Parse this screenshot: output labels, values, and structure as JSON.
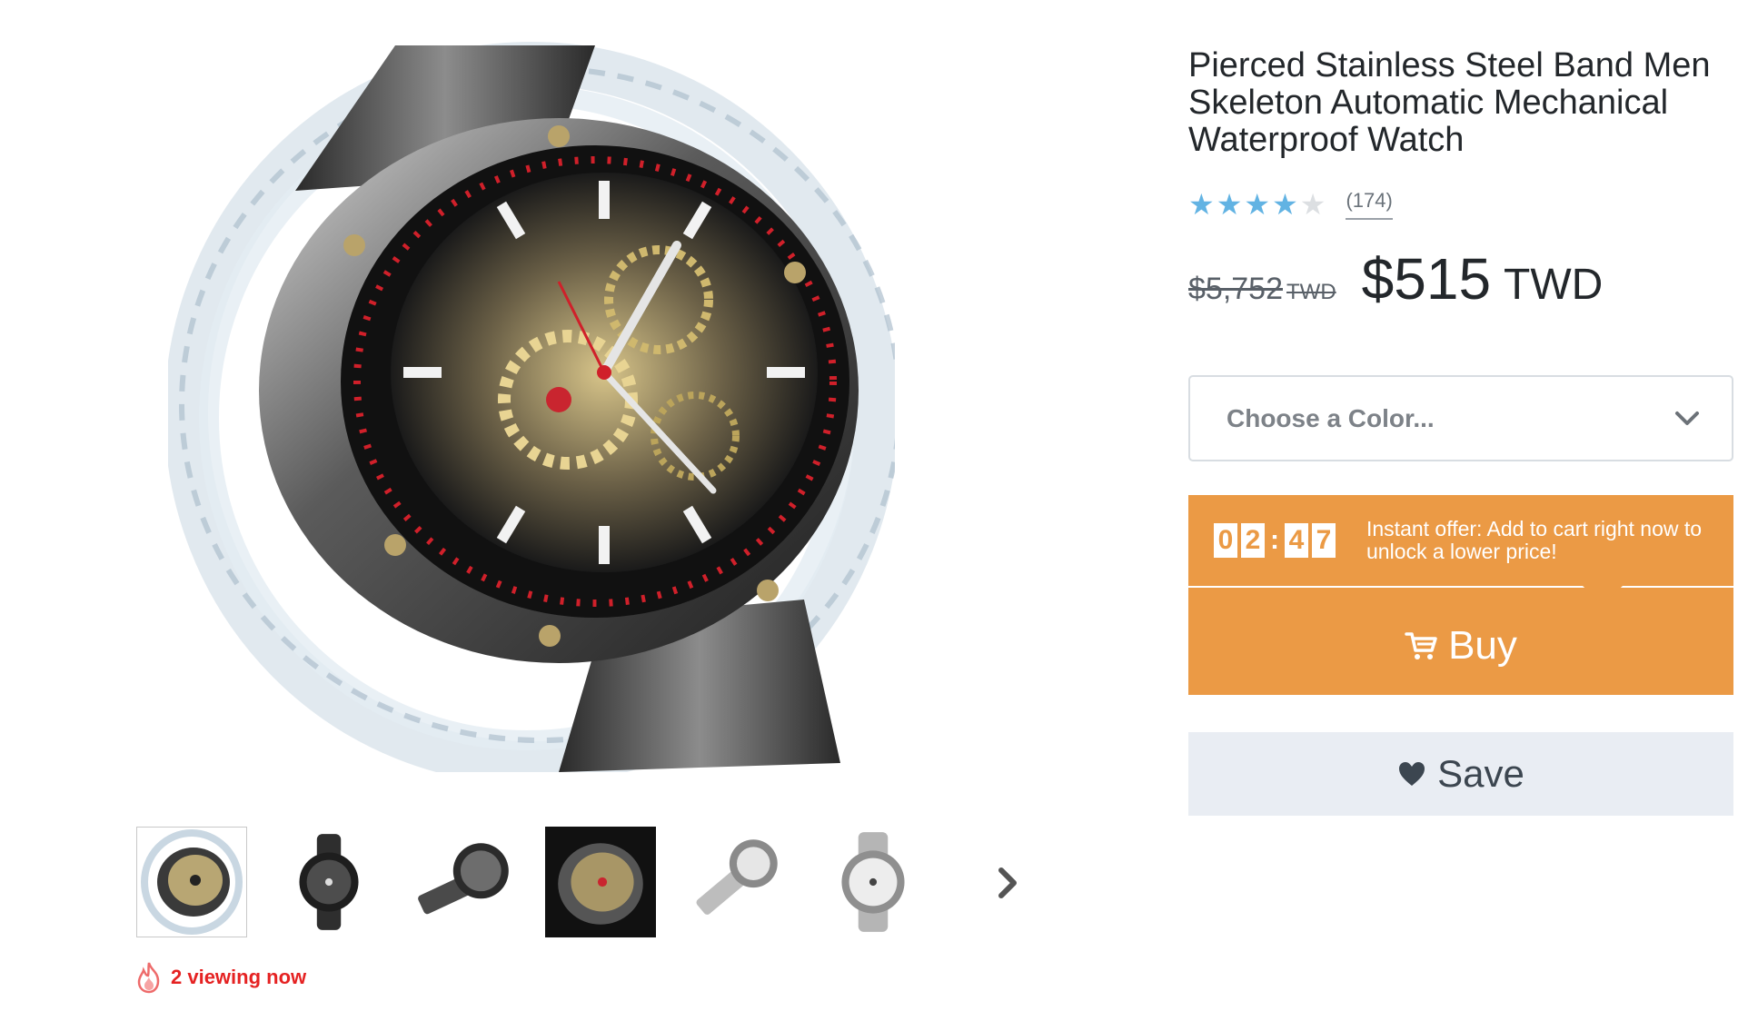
{
  "product": {
    "title": "Pierced Stainless Steel Band Men Skeleton Automatic Mechanical Waterproof Watch",
    "rating": 4,
    "rating_max": 5,
    "review_count": "(174)",
    "original_price": "$5,752",
    "original_currency": "TWD",
    "price": "$515",
    "currency": "TWD"
  },
  "color_select": {
    "placeholder": "Choose a Color..."
  },
  "offer": {
    "countdown_digits": [
      "0",
      "2",
      "4",
      "7"
    ],
    "separator": ":",
    "text": "Instant offer: Add to cart right now to unlock a lower price!"
  },
  "buttons": {
    "buy_label": "Buy",
    "save_label": "Save"
  },
  "gallery": {
    "thumbnail_count": 6,
    "selected_index": 0,
    "next_icon": "chevron-right-icon"
  },
  "social_proof": {
    "viewing_text": "2 viewing now",
    "icon": "flame-icon"
  },
  "colors": {
    "accent_orange": "#eb9a45",
    "star_blue": "#62b3e3",
    "alert_red": "#e52222",
    "save_bg": "#e9edf3"
  }
}
